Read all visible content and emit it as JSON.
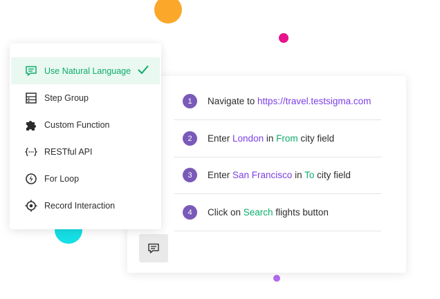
{
  "colors": {
    "accent_green": "#0cac6b",
    "accent_purple": "#7b3fe4",
    "step_badge": "#7a5ab8",
    "dot_orange": "#fba82a",
    "dot_pink": "#e6138a",
    "dot_cyan": "#16dfe6",
    "dot_purple": "#b46cf0"
  },
  "menu": {
    "items": [
      {
        "label": "Use Natural Language",
        "icon": "natural-language-icon",
        "selected": true
      },
      {
        "label": "Step Group",
        "icon": "step-group-icon"
      },
      {
        "label": "Custom Function",
        "icon": "puzzle-icon"
      },
      {
        "label": "RESTful API",
        "icon": "api-icon"
      },
      {
        "label": "For Loop",
        "icon": "loop-icon"
      },
      {
        "label": "Record Interaction",
        "icon": "record-icon"
      }
    ]
  },
  "steps": [
    {
      "num": "1",
      "parts": [
        {
          "t": "Navigate to "
        },
        {
          "t": "https://travel.testsigma.com",
          "hl": "purple"
        }
      ]
    },
    {
      "num": "2",
      "parts": [
        {
          "t": "Enter "
        },
        {
          "t": "London",
          "hl": "purple"
        },
        {
          "t": " in "
        },
        {
          "t": "From",
          "hl": "green"
        },
        {
          "t": " city field"
        }
      ]
    },
    {
      "num": "3",
      "parts": [
        {
          "t": "Enter "
        },
        {
          "t": "San Francisco",
          "hl": "purple"
        },
        {
          "t": " in "
        },
        {
          "t": "To",
          "hl": "green"
        },
        {
          "t": " city field"
        }
      ]
    },
    {
      "num": "4",
      "parts": [
        {
          "t": "Click on "
        },
        {
          "t": "Search",
          "hl": "green"
        },
        {
          "t": " flights button"
        }
      ]
    }
  ],
  "nl_button_icon": "natural-language-icon"
}
